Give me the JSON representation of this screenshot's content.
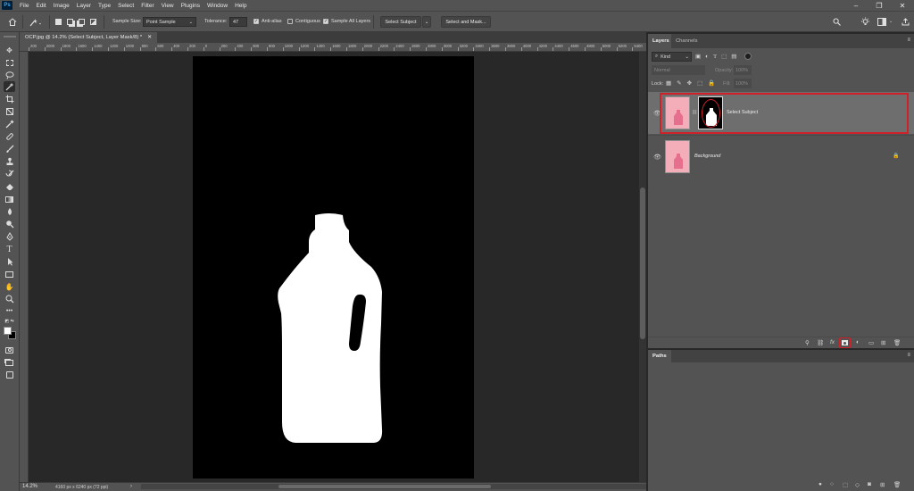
{
  "app": {
    "logo_text": "Ps",
    "menu": [
      "File",
      "Edit",
      "Image",
      "Layer",
      "Type",
      "Select",
      "Filter",
      "View",
      "Plugins",
      "Window",
      "Help"
    ]
  },
  "options_bar": {
    "sample_size_label": "Sample Size:",
    "sample_size_value": "Point Sample",
    "tolerance_label": "Tolerance:",
    "tolerance_value": "47",
    "anti_alias_label": "Anti-alias",
    "anti_alias_checked": true,
    "contiguous_label": "Contiguous",
    "contiguous_checked": false,
    "sample_all_layers_label": "Sample All Layers",
    "sample_all_layers_checked": true,
    "select_subject_label": "Select Subject",
    "select_and_mask_label": "Select and Mask..."
  },
  "document": {
    "tab_title": "OCP.jpg @ 14.2% (Select Subject, Layer Mask/8) *",
    "zoom": "14.2%",
    "dimensions": "4160 px x 6240 px (72 ppi)",
    "ruler_labels": [
      "200",
      "2000",
      "1800",
      "1600",
      "1400",
      "1200",
      "1000",
      "800",
      "600",
      "400",
      "200",
      "0",
      "200",
      "400",
      "600",
      "800",
      "1000",
      "1200",
      "1400",
      "1600",
      "1800",
      "2000",
      "2200",
      "2400",
      "2600",
      "2800",
      "3000",
      "3200",
      "3400",
      "3600",
      "3800",
      "4000",
      "4200",
      "4400",
      "4600",
      "4800",
      "5000",
      "5200",
      "5400",
      "5600"
    ]
  },
  "layers_panel": {
    "tabs": [
      "Layers",
      "Channels"
    ],
    "filter_kind": "Kind",
    "blend_mode": "Normal",
    "opacity_label": "Opacity:",
    "opacity_value": "100%",
    "lock_label": "Lock:",
    "fill_label": "Fill:",
    "fill_value": "100%",
    "layers": [
      {
        "name": "Select Subject",
        "selected": true,
        "has_mask": true
      },
      {
        "name": "Background",
        "selected": false,
        "locked": true
      }
    ]
  },
  "paths_panel": {
    "tab": "Paths"
  },
  "colors": {
    "highlight_red": "#d0202a",
    "pink_background": "#f3aeb9"
  }
}
